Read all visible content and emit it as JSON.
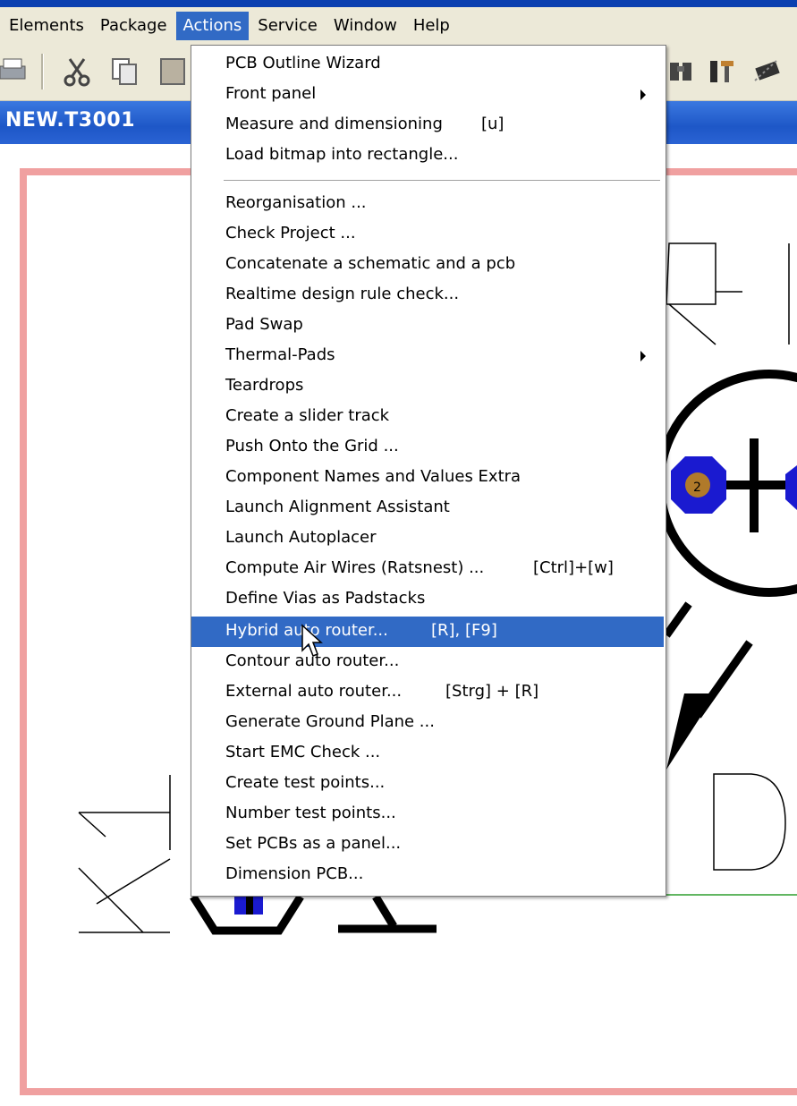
{
  "menubar": {
    "items": [
      {
        "label": "Elements"
      },
      {
        "label": "Package"
      },
      {
        "label": "Actions",
        "active": true
      },
      {
        "label": "Service"
      },
      {
        "label": "Window"
      },
      {
        "label": "Help"
      }
    ]
  },
  "toolbar": {
    "left_icons": [
      "printer-icon",
      "cut-icon",
      "copy-icon",
      "paste-icon"
    ],
    "right_icons": [
      "binoculars-icon",
      "tools-icon",
      "chip-icon"
    ]
  },
  "document": {
    "title": "NEW.T3001"
  },
  "actions_menu": {
    "items": [
      {
        "label": "PCB Outline Wizard",
        "shortcut": ""
      },
      {
        "label": "Front panel",
        "shortcut": "",
        "submenu": true
      },
      {
        "label": "Measure and dimensioning",
        "shortcut": "[u]"
      },
      {
        "label": "Load bitmap into rectangle...",
        "shortcut": ""
      },
      {
        "label": "Reorganisation ...",
        "shortcut": ""
      },
      {
        "label": "Check Project ...",
        "shortcut": ""
      },
      {
        "label": "Concatenate a schematic and a pcb",
        "shortcut": ""
      },
      {
        "label": "Realtime design rule check...",
        "shortcut": ""
      },
      {
        "label": "Pad Swap",
        "shortcut": ""
      },
      {
        "label": "Thermal-Pads",
        "shortcut": "",
        "submenu": true
      },
      {
        "label": "Teardrops",
        "shortcut": ""
      },
      {
        "label": "Create a slider track",
        "shortcut": ""
      },
      {
        "label": "Push Onto the Grid ...",
        "shortcut": ""
      },
      {
        "label": "Component Names and Values Extra",
        "shortcut": ""
      },
      {
        "label": "Launch Alignment Assistant",
        "shortcut": ""
      },
      {
        "label": "Launch Autoplacer",
        "shortcut": ""
      },
      {
        "label": "Compute Air Wires (Ratsnest) ...",
        "shortcut": "[Ctrl]+[w]"
      },
      {
        "label": "Define Vias as Padstacks",
        "shortcut": ""
      },
      {
        "label": "Hybrid auto router...",
        "shortcut": "[R], [F9]",
        "highlighted": true
      },
      {
        "label": "Contour auto router...",
        "shortcut": ""
      },
      {
        "label": "External auto router...",
        "shortcut": "[Strg] + [R]"
      },
      {
        "label": "Generate Ground Plane ...",
        "shortcut": ""
      },
      {
        "label": "Start EMC Check ...",
        "shortcut": ""
      },
      {
        "label": "Create test points...",
        "shortcut": ""
      },
      {
        "label": "Number test points...",
        "shortcut": ""
      },
      {
        "label": "Set PCBs as a panel...",
        "shortcut": ""
      },
      {
        "label": "Dimension PCB...",
        "shortcut": ""
      }
    ]
  },
  "canvas": {
    "pad_label": "2"
  },
  "colors": {
    "menu_highlight": "#316ac5",
    "board_outline": "#f0a0a0",
    "pad_blue": "#1a1ad0",
    "pad_copper": "#b07a2a",
    "title_bar": "#1e57c7"
  }
}
